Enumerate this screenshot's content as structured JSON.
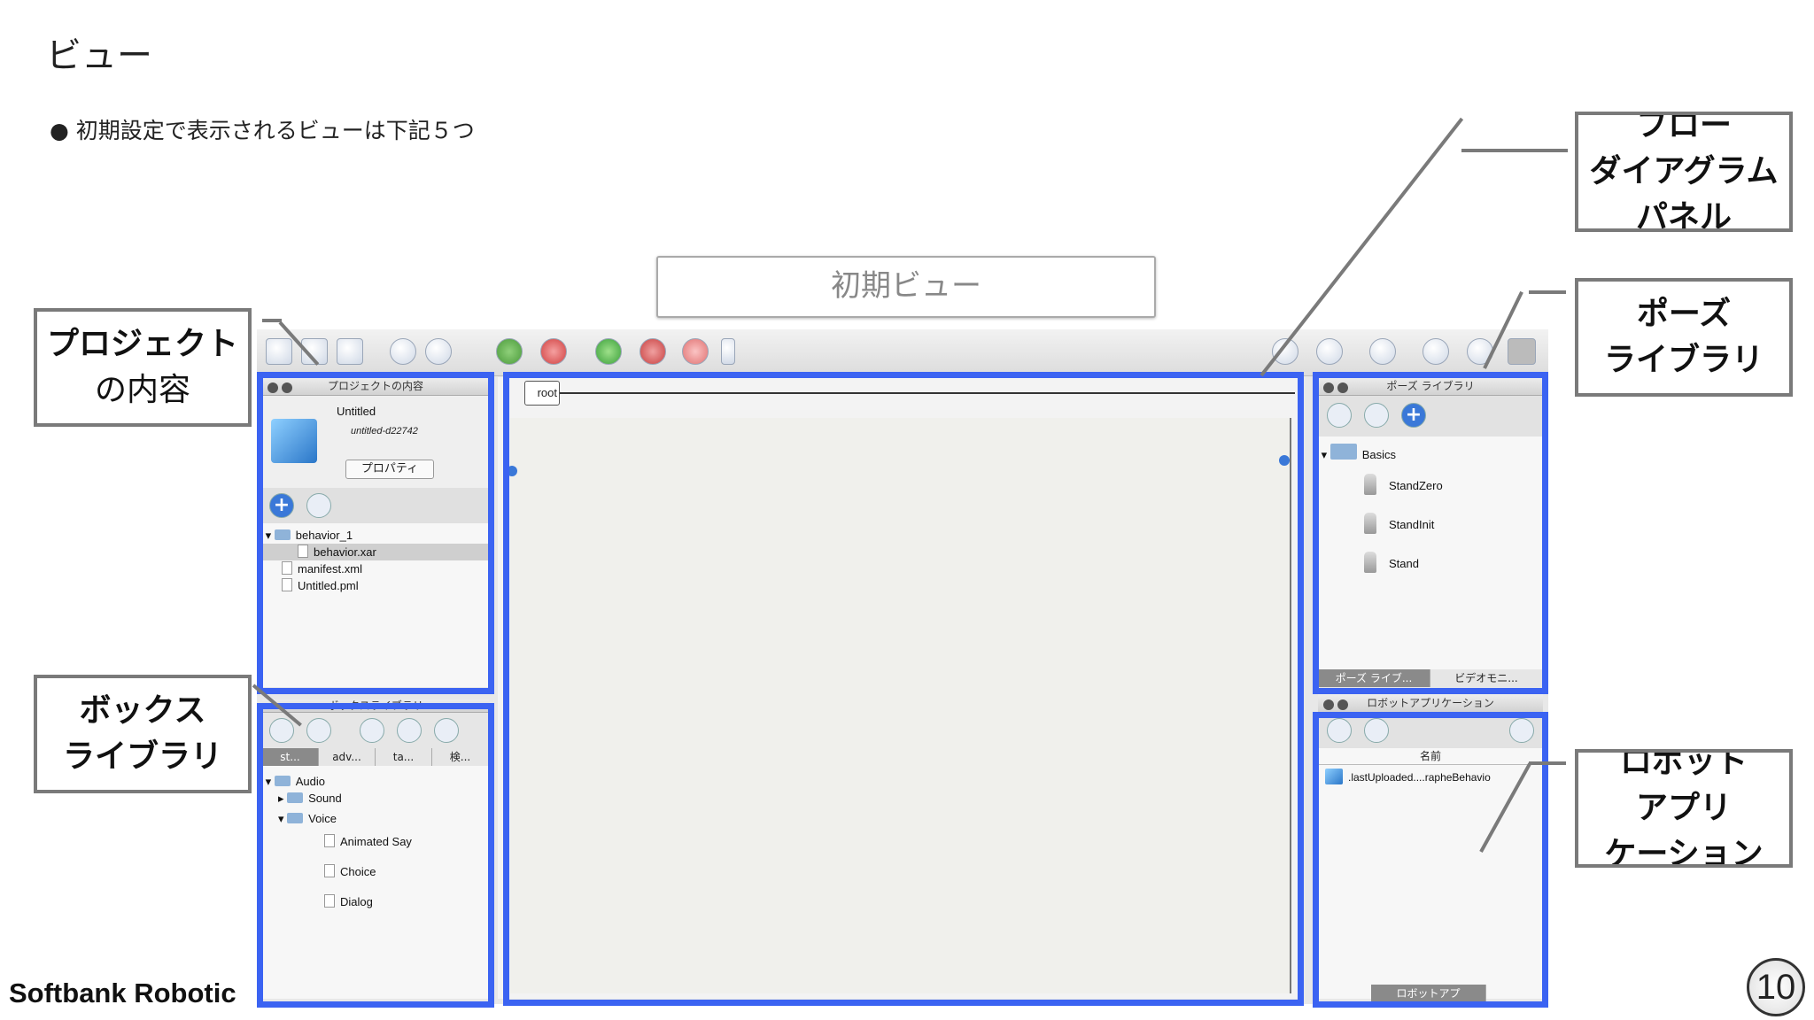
{
  "slide": {
    "title": "ビュー",
    "bullet": "初期設定で表示されるビューは下記５つ",
    "initial_view_label": "初期ビュー",
    "footer": "Softbank Robotic",
    "page_number": "10"
  },
  "callouts": {
    "project_line1": "プロジェクト",
    "project_line2": "の内容",
    "box_line1": "ボックス",
    "box_line2": "ライブラリ",
    "flow_line1": "フロー",
    "flow_line2": "ダイアグラム",
    "flow_line3": "パネル",
    "pose_line1": "ポーズ",
    "pose_line2": "ライブラリ",
    "robot_line1": "ロボット",
    "robot_line2": "アプリ",
    "robot_line3": "ケーション"
  },
  "project_panel": {
    "header": "プロジェクトの内容",
    "name": "Untitled",
    "id": "untitled-d22742",
    "properties_button": "プロパティ",
    "tree": [
      "behavior_1",
      "behavior.xar",
      "manifest.xml",
      "Untitled.pml"
    ]
  },
  "box_panel": {
    "header": "ボックスライブラリ",
    "tabs": [
      "st...",
      "adv...",
      "ta...",
      "検..."
    ],
    "tree": [
      "Audio",
      "Sound",
      "Voice",
      "Animated Say",
      "Choice",
      "Dialog"
    ]
  },
  "flow_panel": {
    "root_label": "root"
  },
  "pose_panel": {
    "header": "ポーズ ライブラリ",
    "folder": "Basics",
    "poses": [
      "StandZero",
      "StandInit",
      "Stand"
    ],
    "tabs": [
      "ポーズ ライブ...",
      "ビデオモニ..."
    ]
  },
  "robot_panel": {
    "header": "ロボットアプリケーション",
    "column_name": "名前",
    "item": ".lastUploaded....rapheBehavio",
    "tab": "ロボットアプ"
  },
  "colors": {
    "highlight": "#3b63f2",
    "callout_border": "#7a7a7a"
  }
}
